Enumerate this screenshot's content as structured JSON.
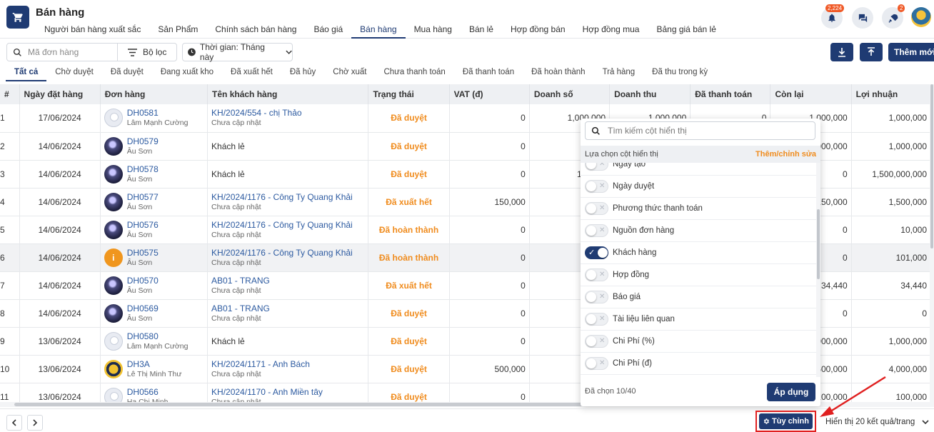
{
  "header": {
    "title": "Bán hàng",
    "nav": [
      "Người bán hàng xuất sắc",
      "Sản Phẩm",
      "Chính sách bán hàng",
      "Báo giá",
      "Bán hàng",
      "Mua hàng",
      "Bán lẻ",
      "Hợp đồng bán",
      "Hợp đồng mua",
      "Bảng giá bán lẻ"
    ],
    "active_nav": "Bán hàng",
    "notification_badge": "2,224",
    "rocket_badge": "2"
  },
  "toolbar": {
    "search_placeholder": "Mã đơn hàng",
    "filter_label": "Bộ lọc",
    "time_label": "Thời gian: Tháng này",
    "add_label": "Thêm mới"
  },
  "status_tabs": [
    "Tất cả",
    "Chờ duyệt",
    "Đã duyệt",
    "Đang xuất kho",
    "Đã xuất hết",
    "Đã hủy",
    "Chờ xuất",
    "Chưa thanh toán",
    "Đã thanh toán",
    "Đã hoàn thành",
    "Trả hàng",
    "Đã thu trong kỳ"
  ],
  "table": {
    "columns": [
      "#",
      "Ngày đặt hàng",
      "Đơn hàng",
      "Tên khách hàng",
      "Trạng thái",
      "VAT (đ)",
      "Doanh số",
      "Doanh thu",
      "Đã thanh toán",
      "Còn lại",
      "Lợi nhuận"
    ],
    "rows": [
      {
        "idx": "1",
        "date": "17/06/2024",
        "code": "DH0581",
        "seller": "Lâm Mạnh Cường",
        "avatar": "blank",
        "customer": "KH/2024/554 - chị Thảo",
        "customer_link": true,
        "customer_sub": "Chưa cập nhật",
        "status": "Đã duyệt",
        "vat": "0",
        "sales": "1,000,000",
        "revenue": "1,000,000",
        "paid": "0",
        "remaining": "1,000,000",
        "profit": "1,000,000"
      },
      {
        "idx": "2",
        "date": "14/06/2024",
        "code": "DH0579",
        "seller": "Âu Sơn",
        "avatar": "photo",
        "customer": "Khách lẻ",
        "customer_link": false,
        "customer_sub": "",
        "status": "Đã duyệt",
        "vat": "0",
        "sales": "1,0",
        "revenue": "",
        "paid": "",
        "remaining": "1,000,000",
        "profit": "1,000,000"
      },
      {
        "idx": "3",
        "date": "14/06/2024",
        "code": "DH0578",
        "seller": "Âu Sơn",
        "avatar": "photo",
        "customer": "Khách lẻ",
        "customer_link": false,
        "customer_sub": "",
        "status": "Đã duyệt",
        "vat": "0",
        "sales": "1,500,0",
        "revenue": "",
        "paid": "",
        "remaining": "0",
        "profit": "1,500,000,000"
      },
      {
        "idx": "4",
        "date": "14/06/2024",
        "code": "DH0577",
        "seller": "Âu Sơn",
        "avatar": "photo",
        "customer": "KH/2024/1176 - Công Ty Quang Khải",
        "customer_link": true,
        "customer_sub": "Chưa cập nhật",
        "status": "Đã xuất hết",
        "vat": "150,000",
        "sales": "1,5",
        "revenue": "",
        "paid": "",
        "remaining": "150,000",
        "profit": "1,500,000"
      },
      {
        "idx": "5",
        "date": "14/06/2024",
        "code": "DH0576",
        "seller": "Âu Sơn",
        "avatar": "photo",
        "customer": "KH/2024/1176 - Công Ty Quang Khải",
        "customer_link": true,
        "customer_sub": "Chưa cập nhật",
        "status": "Đã hoàn thành",
        "vat": "0",
        "sales": "",
        "revenue": "",
        "paid": "",
        "remaining": "0",
        "profit": "10,000"
      },
      {
        "idx": "6",
        "date": "14/06/2024",
        "code": "DH0575",
        "seller": "Âu Sơn",
        "avatar": "info",
        "customer": "KH/2024/1176 - Công Ty Quang Khải",
        "customer_link": true,
        "customer_sub": "Chưa cập nhật",
        "status": "Đã hoàn thành",
        "vat": "0",
        "sales": "",
        "revenue": "",
        "paid": "",
        "remaining": "0",
        "profit": "101,000"
      },
      {
        "idx": "7",
        "date": "14/06/2024",
        "code": "DH0570",
        "seller": "Âu Sơn",
        "avatar": "photo",
        "customer": "AB01 - TRANG",
        "customer_link": true,
        "customer_sub": "Chưa cập nhật",
        "status": "Đã xuất hết",
        "vat": "0",
        "sales": "",
        "revenue": "",
        "paid": "",
        "remaining": "34,440",
        "profit": "34,440"
      },
      {
        "idx": "8",
        "date": "14/06/2024",
        "code": "DH0569",
        "seller": "Âu Sơn",
        "avatar": "photo",
        "customer": "AB01 - TRANG",
        "customer_link": true,
        "customer_sub": "Chưa cập nhật",
        "status": "Đã duyệt",
        "vat": "0",
        "sales": "",
        "revenue": "",
        "paid": "",
        "remaining": "0",
        "profit": "0"
      },
      {
        "idx": "9",
        "date": "13/06/2024",
        "code": "DH0580",
        "seller": "Lâm Mạnh Cường",
        "avatar": "blank",
        "customer": "Khách lẻ",
        "customer_link": false,
        "customer_sub": "",
        "status": "Đã duyệt",
        "vat": "0",
        "sales": "1,0",
        "revenue": "",
        "paid": "",
        "remaining": "1,000,000",
        "profit": "1,000,000"
      },
      {
        "idx": "10",
        "date": "13/06/2024",
        "code": "DH3A",
        "seller": "Lê Thị Minh Thư",
        "avatar": "yellow",
        "customer": "KH/2024/1171 - Anh Bách",
        "customer_link": true,
        "customer_sub": "Chưa cập nhật",
        "status": "Đã duyệt",
        "vat": "500,000",
        "sales": "4,0",
        "revenue": "",
        "paid": "",
        "remaining": "500,000",
        "profit": "4,000,000"
      },
      {
        "idx": "11",
        "date": "13/06/2024",
        "code": "DH0566",
        "seller": "Ha Chi Minh",
        "avatar": "blank",
        "customer": "KH/2024/1170 - Anh Miền tây",
        "customer_link": true,
        "customer_sub": "Chưa cập nhật",
        "status": "Đã duyệt",
        "vat": "0",
        "sales": "1,0",
        "revenue": "",
        "paid": "",
        "remaining": "100,000",
        "profit": "100,000"
      }
    ]
  },
  "column_panel": {
    "search_placeholder": "Tìm kiếm cột hiển thị",
    "header_label": "Lựa chọn cột hiển thị",
    "header_action": "Thêm/chỉnh sửa",
    "items": [
      {
        "label": "Ngày tạo",
        "on": false
      },
      {
        "label": "Ngày duyệt",
        "on": false
      },
      {
        "label": "Phương thức thanh toán",
        "on": false
      },
      {
        "label": "Nguồn đơn hàng",
        "on": false
      },
      {
        "label": "Khách hàng",
        "on": true
      },
      {
        "label": "Hợp đồng",
        "on": false
      },
      {
        "label": "Báo giá",
        "on": false
      },
      {
        "label": "Tài liệu liên quan",
        "on": false
      },
      {
        "label": "Chi Phí (%)",
        "on": false
      },
      {
        "label": "Chi Phí (đ)",
        "on": false
      }
    ],
    "selected_count": "Đã chọn 10/40",
    "apply_label": "Áp dụng"
  },
  "footer": {
    "custom_label": "Tùy chỉnh",
    "page_size_label": "Hiển thị 20 kết quả/trang"
  },
  "colors": {
    "primary": "#1f3b73",
    "status_orange": "#f08c1e",
    "link_blue": "#2c5aa0",
    "highlight_red": "#e02020"
  }
}
